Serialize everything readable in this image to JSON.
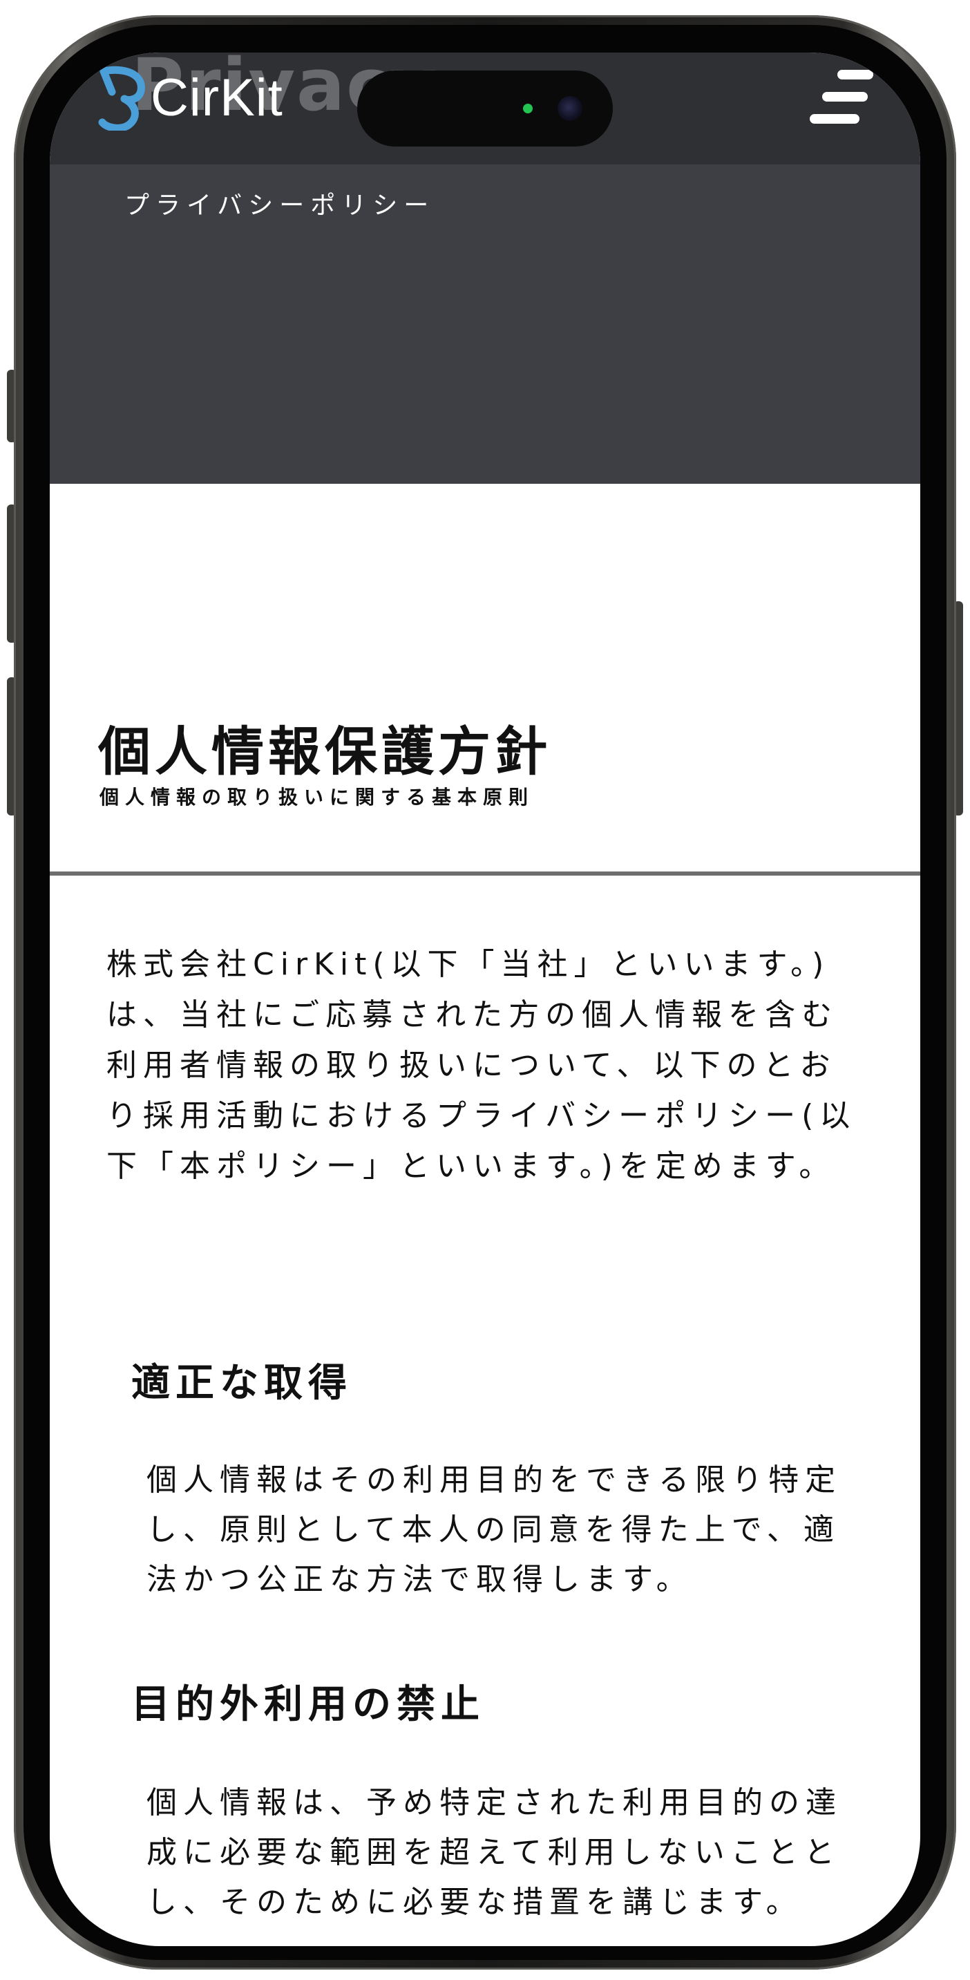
{
  "site": {
    "brand": "CirKit",
    "watermark": "Privacy"
  },
  "hero": {
    "title": "プライバシーポリシー"
  },
  "policy": {
    "heading": "個人情報保護方針",
    "subheading": "個人情報の取り扱いに関する基本原則",
    "intro": "株式会社CirKit(以下「当社」といいます。)は、当社にご応募された方の個人情報を含む利用者情報の取り扱いについて、以下のとおり採用活動におけるプライバシーポリシー(以下「本ポリシー」といいます。)を定めます。",
    "sections": [
      {
        "heading": "適正な取得",
        "body": "個人情報はその利用目的をできる限り特定し、原則として本人の同意を得た上で、適法かつ公正な方法で取得します。"
      },
      {
        "heading": "目的外利用の禁止",
        "body": "個人情報は、予め特定された利用目的の達成に必要な範囲を超えて利用しないこととし、そのために必要な措置を講じます。"
      }
    ]
  },
  "icons": {
    "logo": "cirkit-logo-icon",
    "menu": "hamburger-menu-icon",
    "camera": "front-camera-icon"
  },
  "colors": {
    "header_bg": "#2f3034",
    "hero_bg": "#3e3f44",
    "logo_accent": "#4a9fd8",
    "text": "#111111",
    "divider": "#6e6e6e"
  }
}
